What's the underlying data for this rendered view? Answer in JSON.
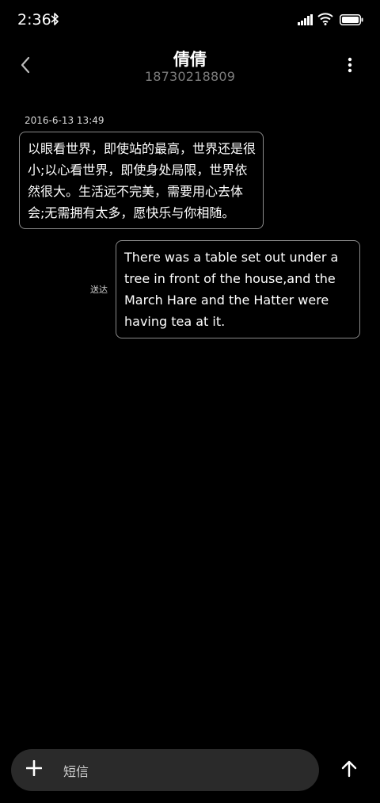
{
  "status_bar": {
    "time": "2:36",
    "icons": [
      "bluetooth-icon",
      "signal-icon",
      "wifi-icon",
      "battery-icon"
    ]
  },
  "header": {
    "contact_name": "倩倩",
    "contact_number": "18730218809",
    "back_icon": "chevron-left-icon",
    "more_icon": "more-vertical-icon"
  },
  "messages": [
    {
      "direction": "incoming",
      "timestamp": "2016-6-13 13:49",
      "text": "以眼看世界，即使站的最高，世界还是很小;以心看世界，即使身处局限，世界依然很大。生活远不完美，需要用心去体会;无需拥有太多，愿快乐与你相随。"
    },
    {
      "direction": "outgoing",
      "status": "送达",
      "text": "There was a table set out under a tree in front of the house,and the March Hare and the Hatter were having tea at it."
    }
  ],
  "composer": {
    "placeholder": "短信",
    "value": "",
    "add_icon": "plus-icon",
    "send_icon": "send-arrow-icon"
  },
  "colors": {
    "background": "#000000",
    "bubble_border": "#8a8a8a",
    "composer_bg": "#2a2a2a",
    "secondary_text": "#7d7d7d"
  }
}
